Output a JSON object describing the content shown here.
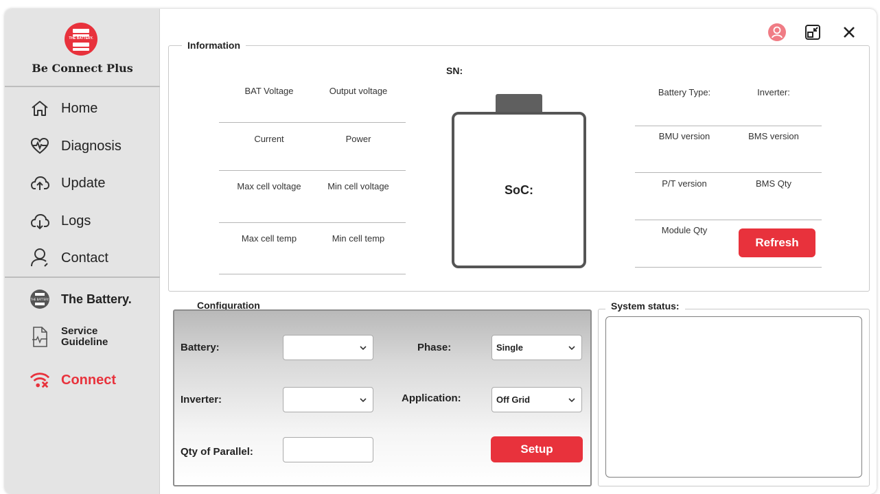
{
  "app": {
    "logo_text": "THE BATTERY.",
    "name": "Be Connect Plus"
  },
  "nav": [
    {
      "label": "Home"
    },
    {
      "label": "Diagnosis"
    },
    {
      "label": "Update"
    },
    {
      "label": "Logs"
    },
    {
      "label": "Contact"
    }
  ],
  "links": {
    "battery_brand": "The Battery.",
    "brand_logo_text": "THE BATTERY.",
    "service_line1": "Service",
    "service_line2": "Guideline",
    "connect": "Connect"
  },
  "information": {
    "title": "Information",
    "sn_label": "SN:",
    "soc_label": "SoC:",
    "left_fields": [
      [
        "BAT Voltage",
        "Output voltage"
      ],
      [
        "Current",
        "Power"
      ],
      [
        "Max cell voltage",
        "Min cell voltage"
      ],
      [
        "Max cell temp",
        "Min cell temp"
      ]
    ],
    "right_fields": [
      [
        "Battery Type:",
        "Inverter:"
      ],
      [
        "BMU version",
        "BMS version"
      ],
      [
        "P/T version",
        "BMS Qty"
      ],
      [
        "Module Qty",
        ""
      ]
    ],
    "refresh_label": "Refresh"
  },
  "configuration": {
    "title": "Configuration",
    "battery_label": "Battery:",
    "battery_value": "",
    "phase_label": "Phase:",
    "phase_value": "Single",
    "inverter_label": "Inverter:",
    "inverter_value": "",
    "application_label": "Application:",
    "application_value": "Off Grid",
    "parallel_label": "Qty of Parallel:",
    "parallel_value": "",
    "setup_label": "Setup"
  },
  "system_status": {
    "title": "System status:",
    "content": ""
  },
  "colors": {
    "accent": "#e8323c",
    "sidebar": "#e4e4e4"
  }
}
